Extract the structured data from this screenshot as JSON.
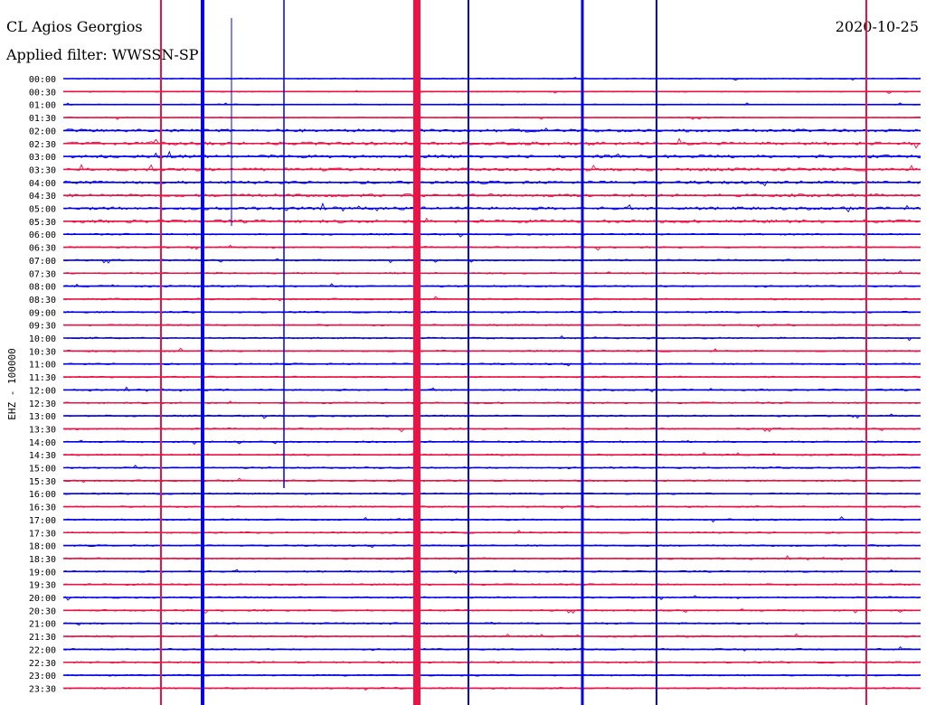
{
  "header": {
    "station": "CL Agios Georgios",
    "filter": "Applied filter: WWSSN-SP",
    "date": "2020-10-25"
  },
  "chart_data": {
    "type": "line",
    "title": "CL Agios Georgios",
    "ylabel": "EHZ - 100000",
    "row_labels": [
      "00:00",
      "00:30",
      "01:00",
      "01:30",
      "02:00",
      "02:30",
      "03:00",
      "03:30",
      "04:00",
      "04:30",
      "05:00",
      "05:30",
      "06:00",
      "06:30",
      "07:00",
      "07:30",
      "08:00",
      "08:30",
      "09:00",
      "09:30",
      "10:00",
      "10:30",
      "11:00",
      "11:30",
      "12:00",
      "12:30",
      "13:00",
      "13:30",
      "14:00",
      "14:30",
      "15:00",
      "15:30",
      "16:00",
      "16:30",
      "17:00",
      "17:30",
      "18:00",
      "18:30",
      "19:00",
      "19:30",
      "20:00",
      "20:30",
      "21:00",
      "21:30",
      "22:00",
      "22:30",
      "23:00",
      "23:30"
    ],
    "trace_colors": [
      "#0000ee",
      "#ee1144"
    ],
    "grid": false
  }
}
